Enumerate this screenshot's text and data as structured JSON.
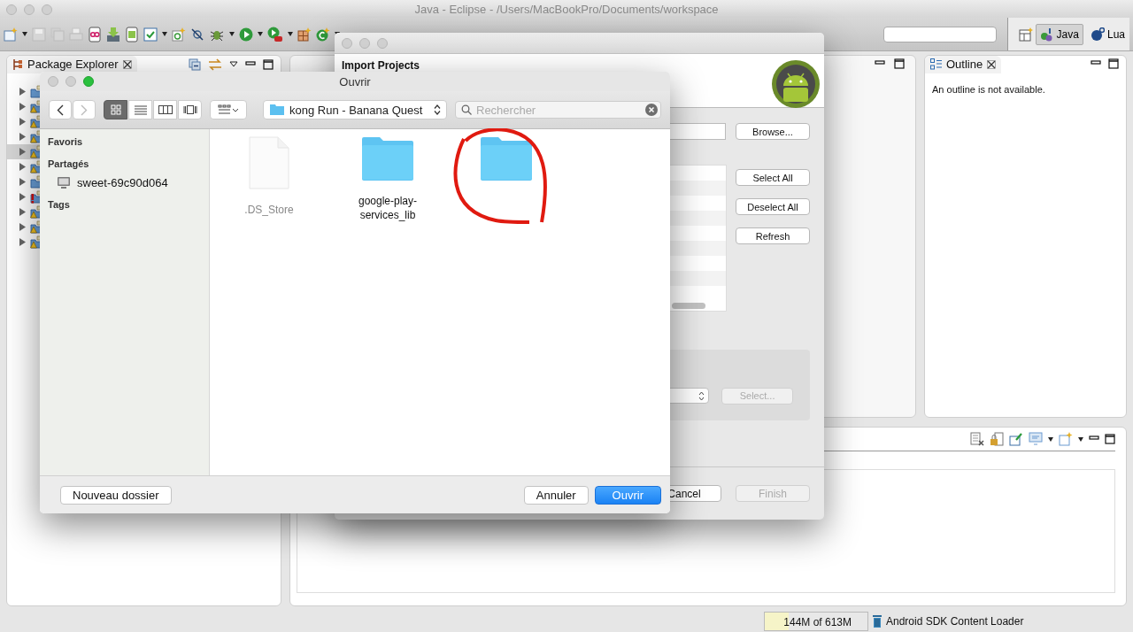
{
  "window": {
    "title": "Java - Eclipse - /Users/MacBookPro/Documents/workspace"
  },
  "toolbar": {
    "perspectives": [
      {
        "label": "Java",
        "selected": true
      },
      {
        "label": "Lua",
        "selected": false
      }
    ]
  },
  "package_explorer": {
    "title": "Package Explorer",
    "projects": [
      {
        "kind": "plain",
        "selected": false
      },
      {
        "kind": "warning",
        "selected": false
      },
      {
        "kind": "warning",
        "selected": false
      },
      {
        "kind": "warning",
        "selected": false
      },
      {
        "kind": "warning",
        "selected": true
      },
      {
        "kind": "warning",
        "selected": false
      },
      {
        "kind": "plain",
        "selected": false
      },
      {
        "kind": "error",
        "selected": false
      },
      {
        "kind": "warning",
        "selected": false
      },
      {
        "kind": "warning",
        "selected": false
      },
      {
        "kind": "warning",
        "selected": false
      }
    ]
  },
  "outline": {
    "title": "Outline",
    "message": "An outline is not available."
  },
  "import_dialog": {
    "title": "Import Projects",
    "side_buttons": [
      {
        "label": "Browse...",
        "disabled": false
      },
      {
        "label": "Select All",
        "disabled": false
      },
      {
        "label": "Deselect All",
        "disabled": false
      },
      {
        "label": "Refresh",
        "disabled": false
      }
    ],
    "working_set_button": {
      "label": "Select...",
      "disabled": true
    },
    "footer_buttons": [
      {
        "label": "Cancel",
        "disabled": false
      },
      {
        "label": "Finish",
        "disabled": true
      }
    ]
  },
  "open_dialog": {
    "title": "Ouvrir",
    "view_modes": [
      {
        "kind": "icons",
        "selected": true
      },
      {
        "kind": "list",
        "selected": false
      },
      {
        "kind": "columns",
        "selected": false
      },
      {
        "kind": "coverflow",
        "selected": false
      }
    ],
    "location": "kong Run - Banana Quest",
    "search": {
      "placeholder": "Rechercher"
    },
    "sidebar": [
      {
        "heading": "Favoris"
      },
      {
        "heading": "Partagés",
        "items": [
          {
            "label": "sweet-69c90d064"
          }
        ]
      },
      {
        "heading": "Tags"
      }
    ],
    "files": [
      {
        "kind": "document",
        "name": ".DS_Store",
        "dimmed": true,
        "circled": false
      },
      {
        "kind": "folder",
        "name": "google-play-services_lib",
        "dimmed": false,
        "circled": false
      },
      {
        "kind": "folder",
        "dimmed": false,
        "circled": true
      }
    ],
    "new_folder_button": "Nouveau dossier",
    "cancel_button": "Annuler",
    "open_button": "Ouvrir"
  },
  "status_bar": {
    "memory": "144M of 613M",
    "level": 0.23,
    "task": "Android SDK Content Loader"
  }
}
